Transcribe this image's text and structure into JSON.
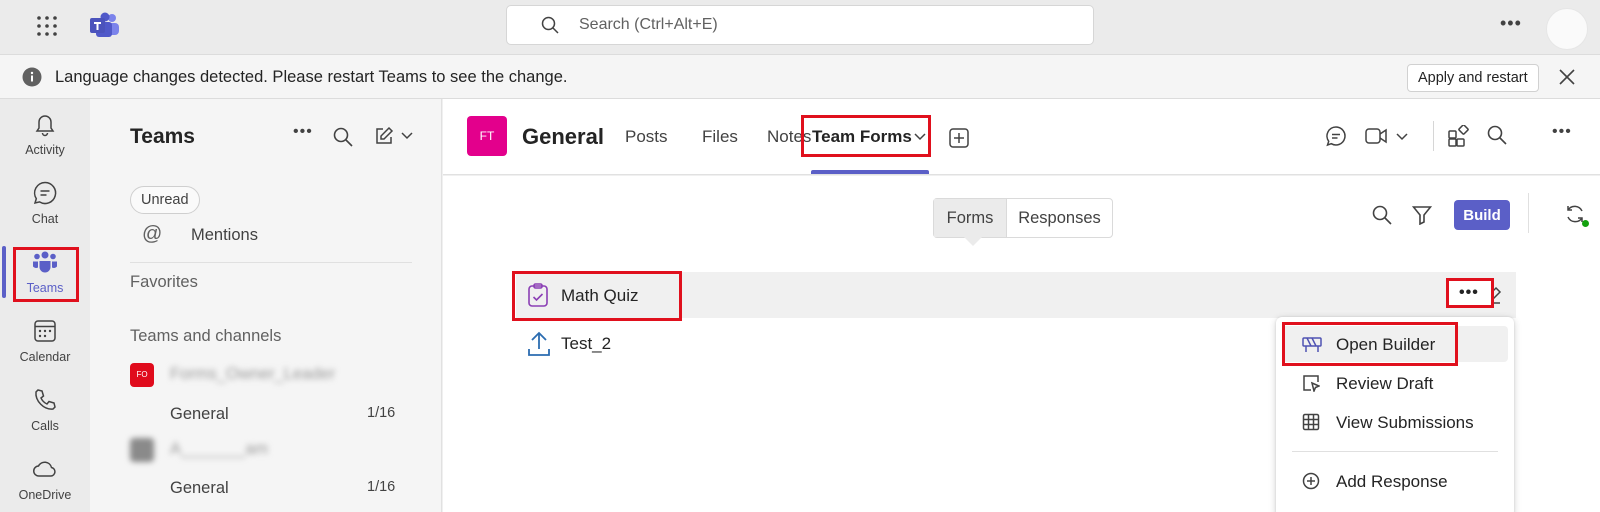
{
  "titlebar": {
    "search_placeholder": "Search (Ctrl+Alt+E)"
  },
  "notification": {
    "message": "Language changes detected. Please restart Teams to see the change.",
    "apply_label": "Apply and restart"
  },
  "rail": {
    "items": [
      {
        "label": "Activity",
        "icon": "bell-icon"
      },
      {
        "label": "Chat",
        "icon": "chat-icon"
      },
      {
        "label": "Teams",
        "icon": "teams-icon",
        "active": true
      },
      {
        "label": "Calendar",
        "icon": "calendar-icon"
      },
      {
        "label": "Calls",
        "icon": "phone-icon"
      },
      {
        "label": "OneDrive",
        "icon": "cloud-icon"
      }
    ]
  },
  "panel": {
    "title": "Teams",
    "filter_chip": "Unread",
    "mentions": "Mentions",
    "favorites_label": "Favorites",
    "teams_channels_label": "Teams and channels",
    "teams": [
      {
        "avatar": "FO",
        "avatar_color": "#e00b1c",
        "name": "Forms_Owner_Leader",
        "channel": "General",
        "count": "1/16"
      },
      {
        "avatar": "",
        "avatar_color": "#8a8a8a",
        "name": "A_______am",
        "channel": "General",
        "count": "1/16"
      }
    ]
  },
  "header": {
    "avatar": "FT",
    "avatar_color": "#e3008c",
    "channel_name": "General",
    "tabs": [
      "Posts",
      "Files",
      "Notes",
      "Team Forms"
    ],
    "active_tab": "Team Forms"
  },
  "content": {
    "segments": [
      "Forms",
      "Responses"
    ],
    "active_segment": "Forms",
    "build_label": "Build",
    "rows": [
      {
        "name": "Math Quiz",
        "icon": "clipboard-check-icon"
      },
      {
        "name": "Test_2",
        "icon": "upload-icon"
      }
    ]
  },
  "menu": {
    "items": [
      {
        "label": "Open Builder",
        "icon": "builder-icon"
      },
      {
        "label": "Review Draft",
        "icon": "review-icon"
      },
      {
        "label": "View Submissions",
        "icon": "table-icon"
      },
      {
        "label": "Add Response",
        "icon": "add-circle-icon"
      }
    ]
  },
  "colors": {
    "accent": "#5b5fc7",
    "highlight": "#e0101d"
  }
}
